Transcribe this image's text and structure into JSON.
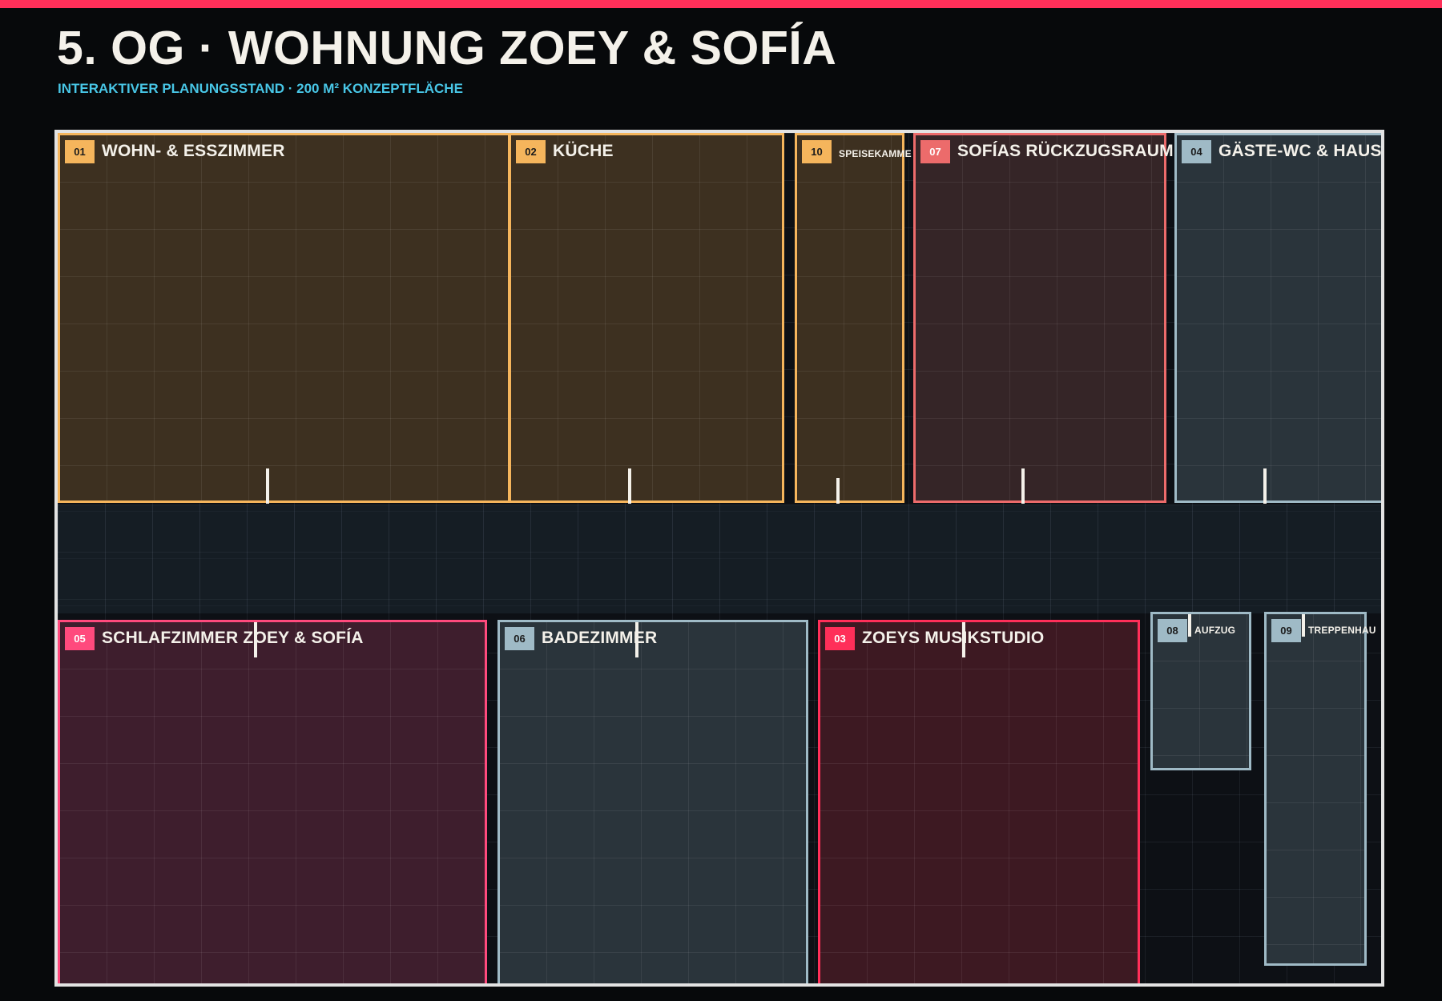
{
  "header": {
    "title": "5. OG · WOHNUNG ZOEY & SOFÍA",
    "subtitle": "INTERAKTIVER PLANUNGSSTAND · 200 M² KONZEPTFLÄCHE"
  },
  "colors": {
    "accent": "#ff2f59",
    "subtitle": "#48c6e6",
    "amber": "#f5b55c",
    "salmon": "#ec6b6b",
    "steel": "#9fbac6",
    "pink": "#ff4a7d"
  },
  "rooms": {
    "wohn": {
      "number": "01",
      "name": "WOHN- & ESSZIMMER"
    },
    "kueche": {
      "number": "02",
      "name": "KÜCHE"
    },
    "speise": {
      "number": "10",
      "name": "SPEISEKAMME"
    },
    "sofia": {
      "number": "07",
      "name": "SOFÍAS RÜCKZUGSRAUM"
    },
    "gaeste": {
      "number": "04",
      "name": "GÄSTE-WC & HAUSWIRTSC"
    },
    "schlaf": {
      "number": "05",
      "name": "SCHLAFZIMMER ZOEY & SOFÍA"
    },
    "bad": {
      "number": "06",
      "name": "BADEZIMMER"
    },
    "studio": {
      "number": "03",
      "name": "ZOEYS MUSIKSTUDIO"
    },
    "aufzug": {
      "number": "08",
      "name": "AUFZUG"
    },
    "treppe": {
      "number": "09",
      "name": "TREPPENHAU"
    }
  }
}
